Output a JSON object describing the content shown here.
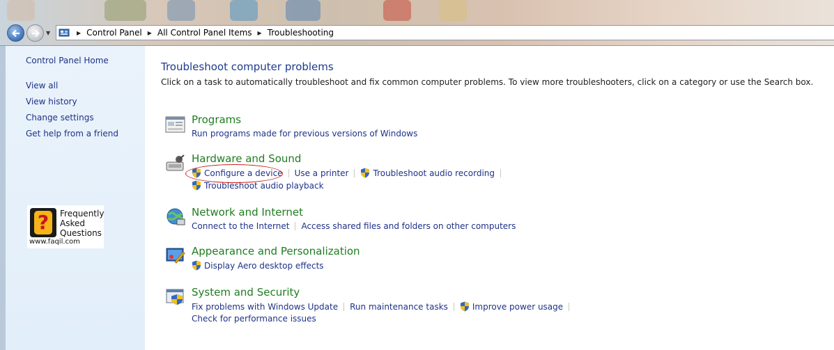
{
  "address": {
    "breadcrumbs": [
      "Control Panel",
      "All Control Panel Items",
      "Troubleshooting"
    ]
  },
  "sidebar": {
    "items": [
      {
        "label": "Control Panel Home"
      },
      {
        "label": "View all"
      },
      {
        "label": "View history"
      },
      {
        "label": "Change settings"
      },
      {
        "label": "Get help from a friend"
      }
    ],
    "faq": {
      "text": "Frequently\nAsked\nQuestions",
      "url": "www.faqil.com",
      "icon": "question-mark"
    }
  },
  "main": {
    "title": "Troubleshoot computer problems",
    "description": "Click on a task to automatically troubleshoot and fix common computer problems. To view more troubleshooters, click on a category or use the Search box.",
    "categories": [
      {
        "title": "Programs",
        "icon": "programs-icon",
        "tasks": [
          {
            "label": "Run programs made for previous versions of Windows",
            "shield": false
          }
        ]
      },
      {
        "title": "Hardware and Sound",
        "icon": "hardware-sound-icon",
        "tasks": [
          {
            "label": "Configure a device",
            "shield": true
          },
          {
            "label": "Use a printer",
            "shield": false
          },
          {
            "label": "Troubleshoot audio recording",
            "shield": true
          },
          {
            "label": "Troubleshoot audio playback",
            "shield": true
          }
        ]
      },
      {
        "title": "Network and Internet",
        "icon": "network-icon",
        "tasks": [
          {
            "label": "Connect to the Internet",
            "shield": false
          },
          {
            "label": "Access shared files and folders on other computers",
            "shield": false
          }
        ]
      },
      {
        "title": "Appearance and Personalization",
        "icon": "appearance-icon",
        "tasks": [
          {
            "label": "Display Aero desktop effects",
            "shield": true
          }
        ]
      },
      {
        "title": "System and Security",
        "icon": "system-security-icon",
        "tasks": [
          {
            "label": "Fix problems with Windows Update",
            "shield": false
          },
          {
            "label": "Run maintenance tasks",
            "shield": false
          },
          {
            "label": "Improve power usage",
            "shield": true
          },
          {
            "label": "Check for performance issues",
            "shield": false
          }
        ]
      }
    ]
  },
  "colors": {
    "link": "#1e3287",
    "category_title": "#1f7d1f",
    "page_title": "#1e3a8c",
    "annotation": "#c8201e"
  }
}
